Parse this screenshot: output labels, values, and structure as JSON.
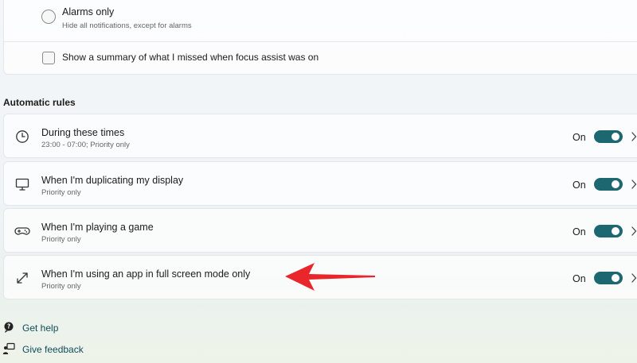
{
  "focus_options": {
    "alarms_only": {
      "label": "Alarms only",
      "description": "Hide all notifications, except for alarms",
      "selected": false
    },
    "summary_checkbox": {
      "label": "Show a summary of what I missed when focus assist was on",
      "checked": false
    }
  },
  "automatic_rules": {
    "heading": "Automatic rules",
    "items": [
      {
        "icon": "clock-icon",
        "title": "During these times",
        "subtitle": "23:00 - 07:00; Priority only",
        "state": "On",
        "enabled": true
      },
      {
        "icon": "monitor-icon",
        "title": "When I'm duplicating my display",
        "subtitle": "Priority only",
        "state": "On",
        "enabled": true
      },
      {
        "icon": "gamepad-icon",
        "title": "When I'm playing a game",
        "subtitle": "Priority only",
        "state": "On",
        "enabled": true
      },
      {
        "icon": "fullscreen-icon",
        "title": "When I'm using an app in full screen mode only",
        "subtitle": "Priority only",
        "state": "On",
        "enabled": true
      }
    ]
  },
  "footer_links": {
    "help": {
      "icon": "help-icon",
      "label": "Get help"
    },
    "feedback": {
      "icon": "feedback-icon",
      "label": "Give feedback"
    }
  },
  "colors": {
    "toggle_on": "#1d6770",
    "link": "#0f4d58",
    "annotation_arrow": "#e8262b"
  }
}
